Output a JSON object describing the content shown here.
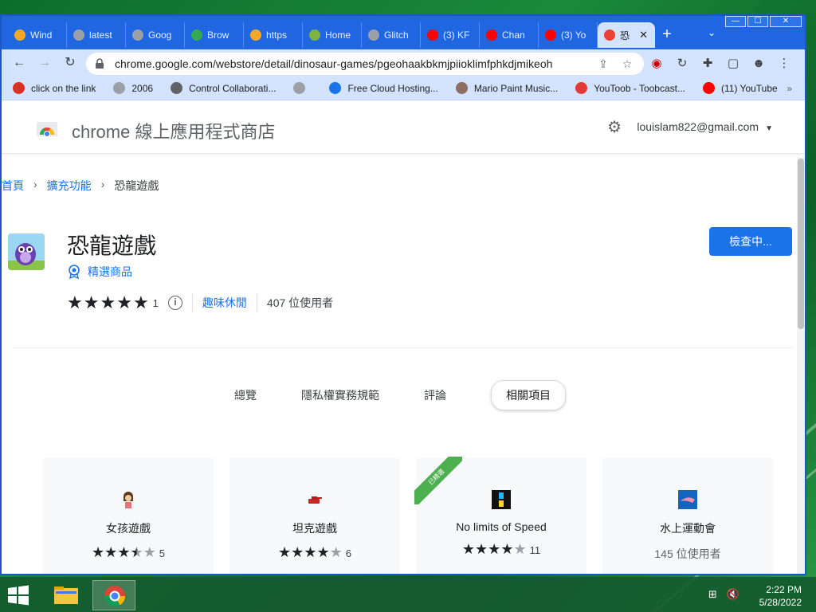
{
  "window": {
    "controls": {
      "minimize": "—",
      "maximize": "☐",
      "close": "✕"
    }
  },
  "tabs": [
    {
      "label": "Wind",
      "color": "#f9a825"
    },
    {
      "label": "latest",
      "color": "#9aa0a6"
    },
    {
      "label": "Goog",
      "color": "#9aa0a6"
    },
    {
      "label": "Brow",
      "color": "#34a853"
    },
    {
      "label": "https",
      "color": "#f9a825"
    },
    {
      "label": "Home",
      "color": "#7cb342"
    },
    {
      "label": "Glitch",
      "color": "#9aa0a6"
    },
    {
      "label": "(3) KF",
      "color": "#ff0000"
    },
    {
      "label": "Chan",
      "color": "#ff0000"
    },
    {
      "label": "(3) Yo",
      "color": "#ff0000"
    },
    {
      "label": "恐",
      "color": "#ea4335",
      "active": true
    }
  ],
  "toolbar": {
    "url": "chrome.google.com/webstore/detail/dinosaur-games/pgeohaakbkmjpiioklimfphkdjmikeoh"
  },
  "bookmarks": [
    {
      "label": "click on the link",
      "color": "#d93025"
    },
    {
      "label": "2006",
      "color": "#9aa0a6"
    },
    {
      "label": "Control Collaborati...",
      "color": "#5f6368"
    },
    {
      "label": "",
      "color": "#9aa0a6"
    },
    {
      "label": "Free Cloud Hosting...",
      "color": "#1a73e8"
    },
    {
      "label": "Mario Paint Music...",
      "color": "#8d6e63"
    },
    {
      "label": "YouToob - Toobcast...",
      "color": "#e53935"
    },
    {
      "label": "(11) YouTube",
      "color": "#ff0000"
    }
  ],
  "store": {
    "title": "chrome 線上應用程式商店",
    "account": "louislam822@gmail.com"
  },
  "breadcrumb": {
    "home": "首頁",
    "extensions": "擴充功能",
    "current": "恐龍遊戲"
  },
  "item": {
    "title": "恐龍遊戲",
    "featured": "精選商品",
    "rating": 5,
    "rating_count": "1",
    "category": "趣味休閒",
    "users": "407 位使用者",
    "button": "檢查中..."
  },
  "nav_tabs": [
    {
      "label": "總覽",
      "active": false
    },
    {
      "label": "隱私權實務規範",
      "active": false
    },
    {
      "label": "評論",
      "active": false
    },
    {
      "label": "相關項目",
      "active": true
    }
  ],
  "related": [
    {
      "title": "女孩遊戲",
      "rating": 3.5,
      "count": "5"
    },
    {
      "title": "坦克遊戲",
      "rating": 4,
      "count": "6"
    },
    {
      "title": "No limits of Speed",
      "rating": 4,
      "count": "11",
      "ribbon": "已精選"
    },
    {
      "title": "水上運動會",
      "users": "145 位使用者"
    }
  ],
  "taskbar": {
    "time": "2:22 PM",
    "date": "5/28/2022"
  }
}
